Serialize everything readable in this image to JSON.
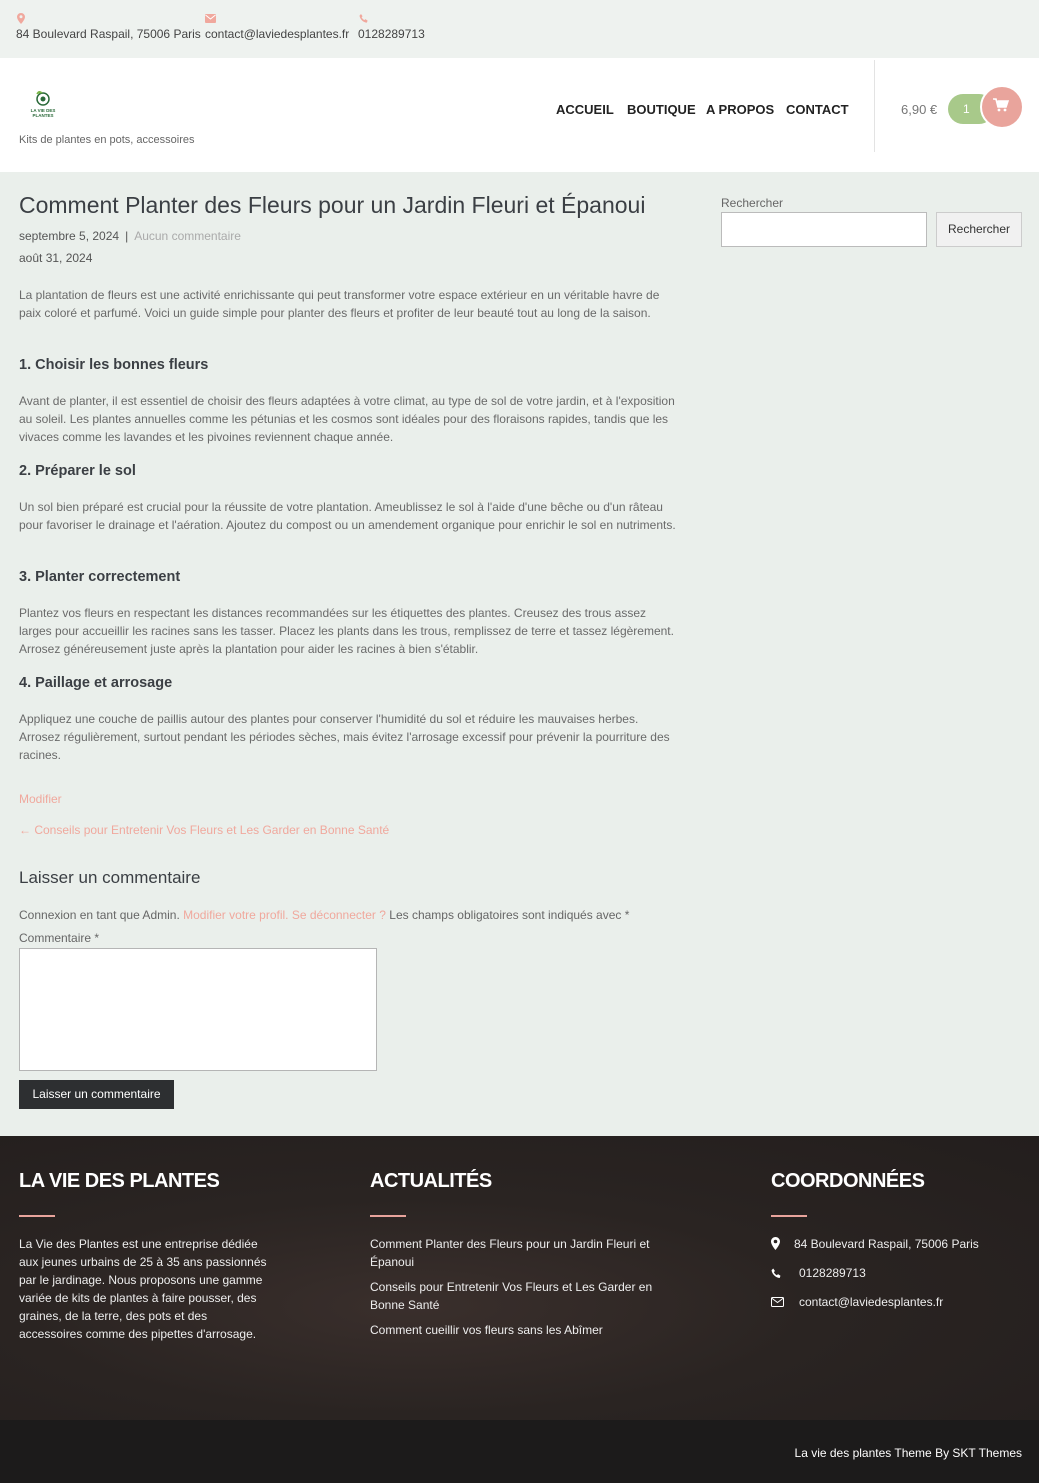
{
  "topbar": {
    "address": "84 Boulevard Raspail, 75006 Paris",
    "email": "contact@laviedesplantes.fr",
    "phone": "0128289713",
    "icon_color": "#f0a89d"
  },
  "header": {
    "logo_text": "LA VIE DES PLANTES",
    "tagline": "Kits de plantes en pots, accessoires",
    "nav": [
      "ACCUEIL",
      "BOUTIQUE",
      "A PROPOS",
      "CONTACT"
    ],
    "cart_total": "6,90 €",
    "cart_count": "1"
  },
  "post": {
    "title": "Comment Planter des Fleurs pour un Jardin Fleuri et Épanoui",
    "date": "septembre 5, 2024",
    "separator": "|",
    "comments_link": "Aucun commentaire",
    "modified_date": "août 31, 2024",
    "intro": "La plantation de fleurs est une activité enrichissante qui peut transformer votre espace extérieur en un véritable havre de paix coloré et parfumé. Voici un guide simple pour planter des fleurs et profiter de leur beauté tout au long de la saison.",
    "sections": [
      {
        "heading": "1. Choisir les bonnes fleurs",
        "text": "Avant de planter, il est essentiel de choisir des fleurs adaptées à votre climat, au type de sol de votre jardin, et à l'exposition au soleil. Les plantes annuelles comme les pétunias et les cosmos sont idéales pour des floraisons rapides, tandis que les vivaces comme les lavandes et les pivoines reviennent chaque année."
      },
      {
        "heading": "2. Préparer le sol",
        "text": "Un sol bien préparé est crucial pour la réussite de votre plantation. Ameublissez le sol à l'aide d'une bêche ou d'un râteau pour favoriser le drainage et l'aération. Ajoutez du compost ou un amendement organique pour enrichir le sol en nutriments."
      },
      {
        "heading": "3. Planter correctement",
        "text": "Plantez vos fleurs en respectant les distances recommandées sur les étiquettes des plantes. Creusez des trous assez larges pour accueillir les racines sans les tasser. Placez les plants dans les trous, remplissez de terre et tassez légèrement. Arrosez généreusement juste après la plantation pour aider les racines à bien s'établir."
      },
      {
        "heading": "4. Paillage et arrosage",
        "text": "Appliquez une couche de paillis autour des plantes pour conserver l'humidité du sol et réduire les mauvaises herbes. Arrosez régulièrement, surtout pendant les périodes sèches, mais évitez l'arrosage excessif pour prévenir la pourriture des racines."
      }
    ],
    "edit_link": "Modifier",
    "prev_post": "← Conseils pour Entretenir Vos Fleurs et Les Garder en Bonne Santé"
  },
  "comments": {
    "title": "Laisser un commentaire",
    "logged_prefix": "Connexion en tant que Admin.",
    "edit_profile": "Modifier votre profil.",
    "logout": "Se déconnecter ?",
    "required_note": "Les champs obligatoires sont indiqués avec *",
    "comment_label": "Commentaire *",
    "submit": "Laisser un commentaire"
  },
  "sidebar": {
    "search_label": "Rechercher",
    "search_button": "Rechercher",
    "search_value": ""
  },
  "footer": {
    "about_title": "LA VIE DES PLANTES",
    "about_text": "La Vie des Plantes est une entreprise dédiée aux jeunes urbains de 25 à 35 ans passionnés par le jardinage. Nous proposons une gamme variée de kits de plantes à faire pousser, des graines, de la terre, des pots et des accessoires comme des pipettes d'arrosage.",
    "news_title": "ACTUALITÉS",
    "news": [
      "Comment Planter des Fleurs pour un Jardin Fleuri et Épanoui",
      "Conseils pour Entretenir Vos Fleurs et Les Garder en Bonne Santé",
      "Comment cueillir vos fleurs sans les Abîmer"
    ],
    "contact_title": "COORDONNÉES",
    "address": "84 Boulevard Raspail, 75006 Paris",
    "phone": "0128289713",
    "email": "contact@laviedesplantes.fr",
    "accent": "#e9a49c"
  },
  "credits": "La vie des plantes Theme By SKT Themes"
}
